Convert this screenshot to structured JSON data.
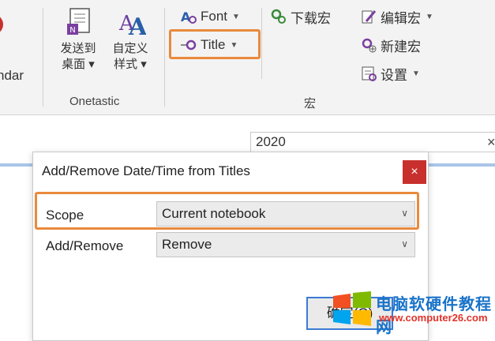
{
  "ribbon": {
    "partial_label": "ndar",
    "onetastic": {
      "send_to_desktop": [
        "发送到",
        "桌面 ▾"
      ],
      "customize_styles": [
        "自定义",
        "样式 ▾"
      ],
      "group_label": "Onetastic"
    },
    "macros": {
      "font_label": "Font",
      "title_label": "Title",
      "download_label": "下载宏",
      "edit_label": "编辑宏",
      "new_label": "新建宏",
      "settings_label": "设置",
      "group_label": "宏"
    }
  },
  "document": {
    "date_value": "2020",
    "clear_glyph": "×"
  },
  "dialog": {
    "title": "Add/Remove Date/Time from Titles",
    "close_glyph": "×",
    "scope_label": "Scope",
    "scope_value": "Current notebook",
    "add_remove_label": "Add/Remove",
    "add_remove_value": "Remove",
    "ok_label": "确定(O)"
  },
  "watermark": {
    "name": "电脑软硬件教程网",
    "url": "www.computer26.com"
  },
  "colors": {
    "highlight": "#e98a3c",
    "close_red": "#c8302d",
    "accent_blue": "#3a7bd5"
  }
}
